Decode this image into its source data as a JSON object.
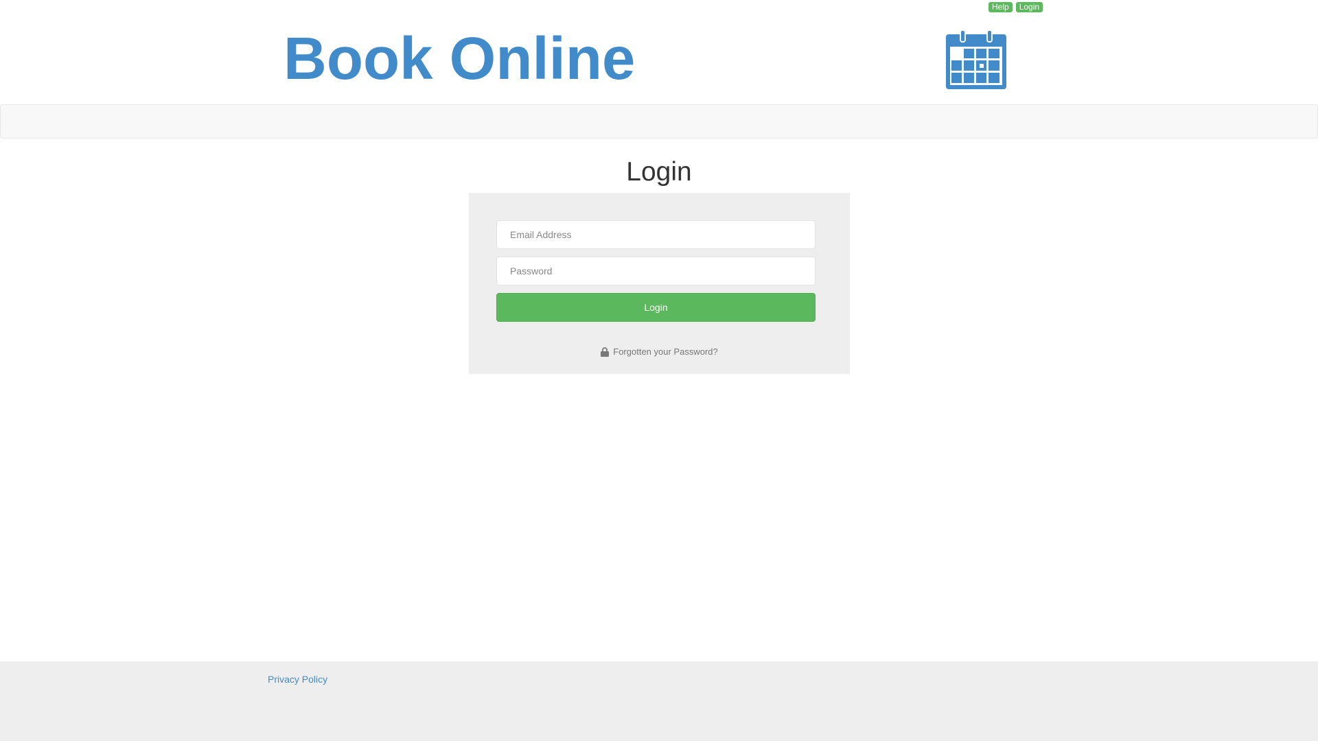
{
  "top_links": {
    "help_label": "Help",
    "login_label": "Login",
    "badge_color": "#5cb85c"
  },
  "header": {
    "brand_title": "Book Online",
    "brand_color": "#428bca",
    "logo_icon": "calendar-icon"
  },
  "main": {
    "page_title": "Login",
    "email_placeholder": "Email Address",
    "email_value": "",
    "password_placeholder": "Password",
    "password_value": "",
    "login_button_label": "Login",
    "login_button_color": "#5cb85c",
    "forgot_password_label": "Forgotten your Password?",
    "forgot_icon": "lock-icon"
  },
  "footer": {
    "privacy_label": "Privacy Policy"
  }
}
